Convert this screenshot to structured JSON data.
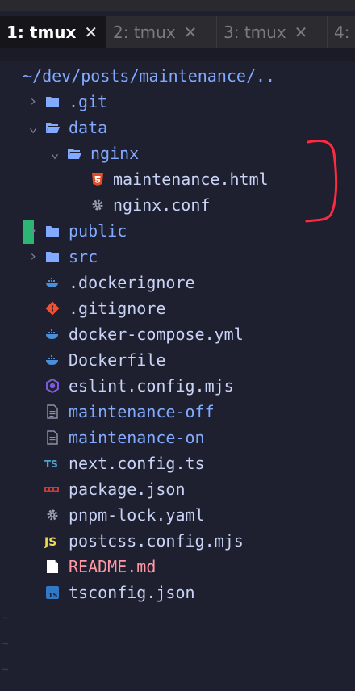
{
  "tabs": [
    {
      "label": "1: tmux",
      "active": true
    },
    {
      "label": "2: tmux",
      "active": false
    },
    {
      "label": "3: tmux",
      "active": false
    },
    {
      "label": "4:",
      "active": false
    }
  ],
  "tab_close_glyph": "✕",
  "tree": {
    "path": "~/dev/posts/maintenance/..",
    "items": [
      {
        "name": ".git",
        "kind": "folder",
        "expanded": false,
        "depth": 0,
        "icon": "folder-icon"
      },
      {
        "name": "data",
        "kind": "folder",
        "expanded": true,
        "depth": 0,
        "icon": "folder-open-icon"
      },
      {
        "name": "nginx",
        "kind": "folder",
        "expanded": true,
        "depth": 1,
        "icon": "folder-open-icon"
      },
      {
        "name": "maintenance.html",
        "kind": "file",
        "depth": 2,
        "icon": "html5-icon"
      },
      {
        "name": "nginx.conf",
        "kind": "file",
        "depth": 2,
        "icon": "gear-icon"
      },
      {
        "name": "public",
        "kind": "folder",
        "expanded": false,
        "depth": 0,
        "icon": "folder-icon",
        "git_status": "modified"
      },
      {
        "name": "src",
        "kind": "folder",
        "expanded": false,
        "depth": 0,
        "icon": "folder-icon"
      },
      {
        "name": ".dockerignore",
        "kind": "file",
        "depth": 0,
        "icon": "docker-icon"
      },
      {
        "name": ".gitignore",
        "kind": "file",
        "depth": 0,
        "icon": "git-icon"
      },
      {
        "name": "docker-compose.yml",
        "kind": "file",
        "depth": 0,
        "icon": "docker-icon"
      },
      {
        "name": "Dockerfile",
        "kind": "file",
        "depth": 0,
        "icon": "docker-icon"
      },
      {
        "name": "eslint.config.mjs",
        "kind": "file",
        "depth": 0,
        "icon": "eslint-icon"
      },
      {
        "name": "maintenance-off",
        "kind": "file",
        "depth": 0,
        "icon": "text-file-icon",
        "highlight": "blue"
      },
      {
        "name": "maintenance-on",
        "kind": "file",
        "depth": 0,
        "icon": "text-file-icon",
        "highlight": "blue"
      },
      {
        "name": "next.config.ts",
        "kind": "file",
        "depth": 0,
        "icon": "typescript-icon"
      },
      {
        "name": "package.json",
        "kind": "file",
        "depth": 0,
        "icon": "npm-icon"
      },
      {
        "name": "pnpm-lock.yaml",
        "kind": "file",
        "depth": 0,
        "icon": "gear-icon"
      },
      {
        "name": "postcss.config.mjs",
        "kind": "file",
        "depth": 0,
        "icon": "javascript-icon"
      },
      {
        "name": "README.md",
        "kind": "file",
        "depth": 0,
        "icon": "markdown-icon",
        "highlight": "pink"
      },
      {
        "name": "tsconfig.json",
        "kind": "file",
        "depth": 0,
        "icon": "tsconfig-icon"
      }
    ]
  },
  "annotation": {
    "color": "#ff2a3d",
    "shape": "bracket"
  },
  "colors": {
    "background": "#1e2030",
    "folder": "#82aaff",
    "text": "#c8d3f5",
    "accent_blue": "#82aaff",
    "accent_pink": "#ff98a4",
    "git_modified": "#2bb673"
  }
}
